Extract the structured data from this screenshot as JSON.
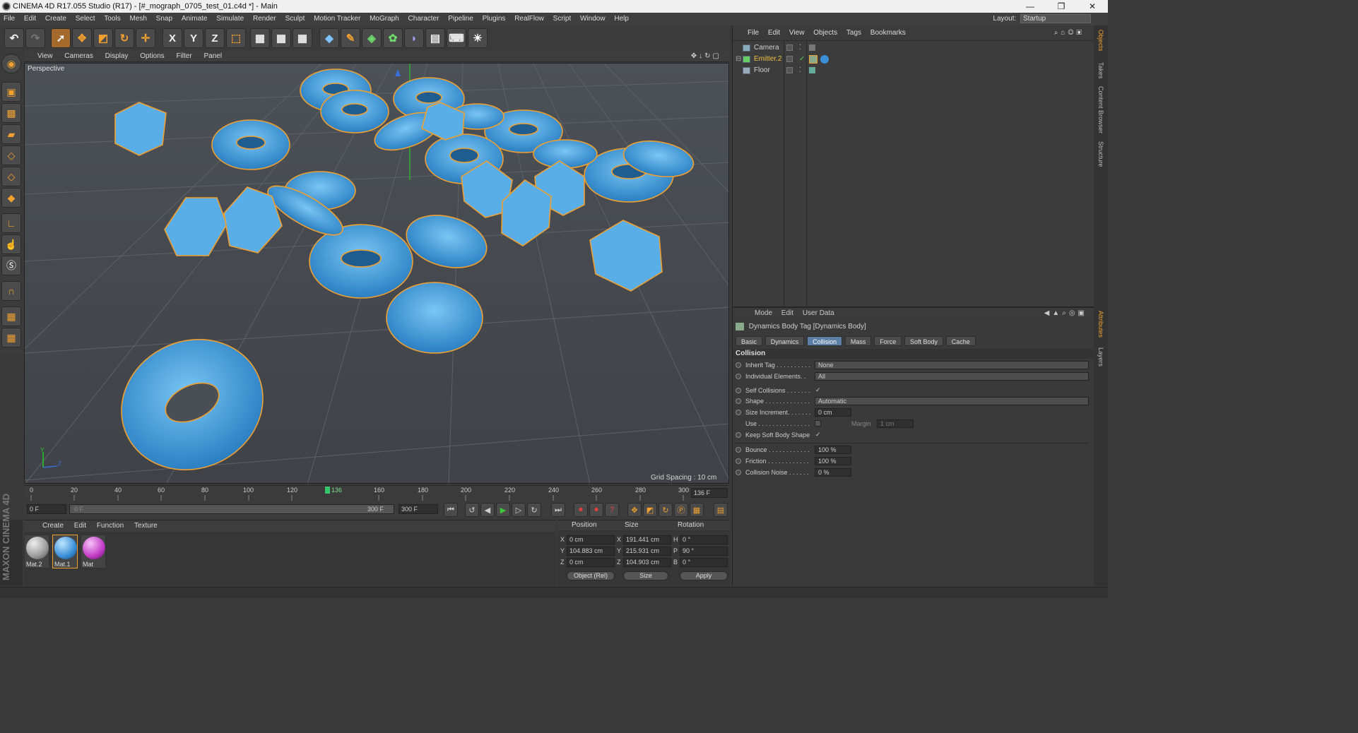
{
  "titlebar": {
    "title": "CINEMA 4D R17.055 Studio (R17) - [#_mograph_0705_test_01.c4d *] - Main",
    "minimize": "—",
    "maximize": "❐",
    "close": "✕"
  },
  "menu": [
    "File",
    "Edit",
    "Create",
    "Select",
    "Tools",
    "Mesh",
    "Snap",
    "Animate",
    "Simulate",
    "Render",
    "Sculpt",
    "Motion Tracker",
    "MoGraph",
    "Character",
    "Pipeline",
    "Plugins",
    "RealFlow",
    "Script",
    "Window",
    "Help"
  ],
  "layout": {
    "label": "Layout:",
    "value": "Startup"
  },
  "toolbar": {
    "x": "X",
    "y": "Y",
    "z": "Z"
  },
  "viewport": {
    "menu": [
      "View",
      "Cameras",
      "Display",
      "Options",
      "Filter",
      "Panel"
    ],
    "label": "Perspective",
    "grid_spacing": "Grid Spacing : 10 cm",
    "axis_y": "Y",
    "axis_z": "Z"
  },
  "timeline": {
    "ticks": [
      "0",
      "20",
      "40",
      "60",
      "80",
      "100",
      "120",
      "136",
      "160",
      "180",
      "200",
      "220",
      "240",
      "260",
      "280",
      "300"
    ],
    "current_frame": "136 F",
    "start_frame": "0 F",
    "range_start": "0 F",
    "range_end": "300 F",
    "end_frame": "300 F"
  },
  "materials": {
    "menu": [
      "Create",
      "Edit",
      "Function",
      "Texture"
    ],
    "items": [
      {
        "name": "Mat.2",
        "color": "#9a9a9a"
      },
      {
        "name": "Mat.1",
        "color": "#3a8fd8"
      },
      {
        "name": "Mat",
        "color": "#c23bc6"
      }
    ]
  },
  "coords": {
    "headers": [
      "Position",
      "Size",
      "Rotation"
    ],
    "rows": [
      {
        "axis": "X",
        "pos": "0 cm",
        "saxis": "X",
        "size": "191.441 cm",
        "raxis": "H",
        "rot": "0 °"
      },
      {
        "axis": "Y",
        "pos": "104.883 cm",
        "saxis": "Y",
        "size": "215.931 cm",
        "raxis": "P",
        "rot": "90 °"
      },
      {
        "axis": "Z",
        "pos": "0 cm",
        "saxis": "Z",
        "size": "104.903 cm",
        "raxis": "B",
        "rot": "0 °"
      }
    ],
    "mode": "Object (Rel)",
    "size_mode": "Size",
    "apply": "Apply"
  },
  "maxon": "MAXON CINEMA 4D",
  "objects": {
    "menu": [
      "File",
      "Edit",
      "View",
      "Objects",
      "Tags",
      "Bookmarks"
    ],
    "items": [
      {
        "name": "Camera"
      },
      {
        "name": "Emitter.2"
      },
      {
        "name": "Floor"
      }
    ]
  },
  "attributes": {
    "menu": [
      "Mode",
      "Edit",
      "User Data"
    ],
    "title": "Dynamics Body Tag [Dynamics Body]",
    "tabs": [
      "Basic",
      "Dynamics",
      "Collision",
      "Mass",
      "Force",
      "Soft Body",
      "Cache"
    ],
    "active_tab": "Collision",
    "section": "Collision",
    "fields": {
      "inherit_tag": {
        "label": "Inherit Tag . . . . . . . . . .",
        "value": "None"
      },
      "individual": {
        "label": "Individual Elements. .",
        "value": "All"
      },
      "self_collisions": {
        "label": "Self Collisions . . . . . . .",
        "value": "✓"
      },
      "shape": {
        "label": "Shape . . . . . . . . . . . . .",
        "value": "Automatic"
      },
      "size_increment": {
        "label": "Size Increment. . . . . . .",
        "value": "0 cm"
      },
      "use": {
        "label": "Use . . . . . . . . . . . . . . .",
        "value": ""
      },
      "margin": {
        "label": "Margin",
        "value": "1 cm"
      },
      "keep_soft": {
        "label": "Keep Soft Body Shape",
        "value": "✓"
      },
      "bounce": {
        "label": "Bounce . . . . . . . . . . . .",
        "value": "100 %"
      },
      "friction": {
        "label": "Friction . . . . . . . . . . . .",
        "value": "100 %"
      },
      "noise": {
        "label": "Collision Noise . . . . . .",
        "value": "0 %"
      }
    }
  },
  "sidetabs": [
    "Objects",
    "Takes",
    "Content Browser",
    "Structure",
    "Attributes",
    "Layers"
  ]
}
